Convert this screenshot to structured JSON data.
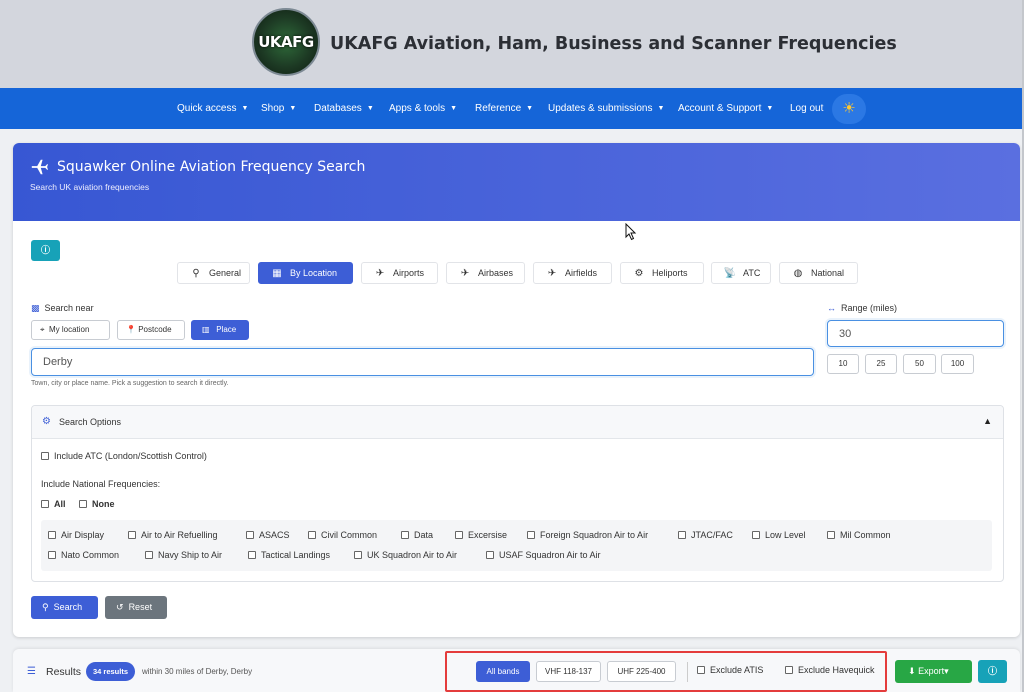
{
  "header": {
    "logo_text": "UKAFG",
    "site_title": "UKAFG Aviation, Ham, Business and Scanner Frequencies"
  },
  "nav": {
    "items": [
      {
        "label": "Quick access"
      },
      {
        "label": "Shop"
      },
      {
        "label": "Databases"
      },
      {
        "label": "Apps & tools"
      },
      {
        "label": "Reference"
      },
      {
        "label": "Updates & submissions"
      },
      {
        "label": "Account & Support"
      },
      {
        "label": "Log out"
      }
    ],
    "theme_icon": "sun-icon"
  },
  "card": {
    "title": "Squawker Online Aviation Frequency Search",
    "subtitle": "Search UK aviation frequencies",
    "info_icon": "info-icon"
  },
  "tabs": [
    {
      "label": "General",
      "icon": "search-icon",
      "active": false
    },
    {
      "label": "By Location",
      "icon": "map-icon",
      "active": true
    },
    {
      "label": "Airports",
      "icon": "plane-departure-icon",
      "active": false
    },
    {
      "label": "Airbases",
      "icon": "fighter-jet-icon",
      "active": false
    },
    {
      "label": "Airfields",
      "icon": "plane-icon",
      "active": false
    },
    {
      "label": "Heliports",
      "icon": "helicopter-icon",
      "active": false
    },
    {
      "label": "ATC",
      "icon": "tower-broadcast-icon",
      "active": false
    },
    {
      "label": "National",
      "icon": "globe-icon",
      "active": false
    }
  ],
  "search_near": {
    "label": "Search near",
    "modes": [
      {
        "label": "My location",
        "icon": "crosshairs-icon",
        "active": false
      },
      {
        "label": "Postcode",
        "icon": "map-pin-icon",
        "active": false
      },
      {
        "label": "Place",
        "icon": "city-icon",
        "active": true
      }
    ],
    "place_value": "Derby",
    "helper": "Town, city or place name. Pick a suggestion to search it directly."
  },
  "range": {
    "label": "Range (miles)",
    "value": "30",
    "presets": [
      "10",
      "25",
      "50",
      "100"
    ]
  },
  "options": {
    "title": "Search Options",
    "include_atc": "Include ATC (London/Scottish Control)",
    "national_label": "Include National Frequencies:",
    "all_label": "All",
    "none_label": "None",
    "frequencies": [
      "Air Display",
      "Air to Air Refuelling",
      "ASACS",
      "Civil Common",
      "Data",
      "Excersise",
      "Foreign Squadron Air to Air",
      "JTAC/FAC",
      "Low Level",
      "Mil Common",
      "Nato Common",
      "Navy Ship to Air",
      "Tactical Landings",
      "UK Squadron Air to Air",
      "USAF Squadron Air to Air"
    ]
  },
  "actions": {
    "search": "Search",
    "reset": "Reset"
  },
  "results": {
    "title": "Results",
    "count": "34 results",
    "within": "within 30 miles of Derby, Derby",
    "bands": [
      {
        "label": "All bands",
        "active": true
      },
      {
        "label": "VHF 118-137",
        "active": false
      },
      {
        "label": "UHF 225-400",
        "active": false
      }
    ],
    "exclude_atis": "Exclude ATIS",
    "exclude_havequick": "Exclude Havequick",
    "export": "Export"
  },
  "colors": {
    "navbar": "#1565d8",
    "primary": "#3d5ed6",
    "info": "#17a2b8",
    "success": "#28a745",
    "highlight": "#e43c3c"
  }
}
